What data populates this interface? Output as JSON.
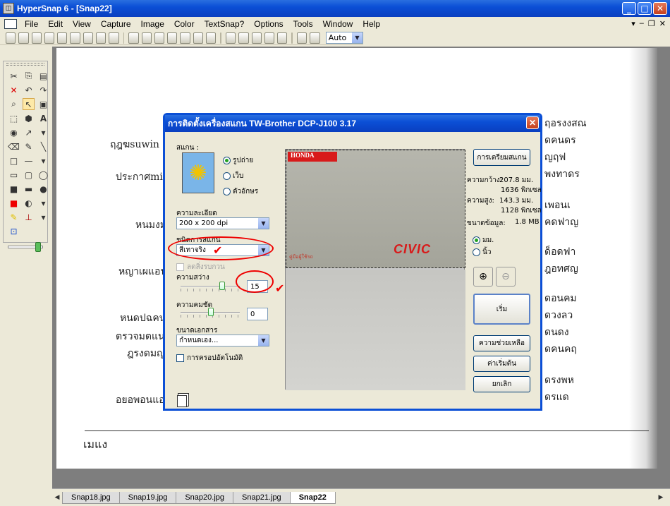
{
  "app": {
    "title": "HyperSnap 6 - [Snap22]",
    "menu": [
      "File",
      "Edit",
      "View",
      "Capture",
      "Image",
      "Color",
      "TextSnap?",
      "Options",
      "Tools",
      "Window",
      "Help"
    ],
    "zoom": "Auto"
  },
  "canvas": {
    "lines": [
      "ฤฎฆsuwin",
      "ประกาศmin",
      "หนมงม",
      "หญาเผแอนน",
      "หนดปฉคนน",
      "ตรวจมตแนว",
      "ฎรงดมญบ",
      "อยอพอนแอา",
      "เมแง"
    ],
    "right_lines": [
      "ฤอรงงสณ",
      "ดคนดร",
      "ญฤฟ",
      "พงทาดร",
      "เพอนเ",
      "คดฟาญ",
      "ด็อดฟา",
      "ฎอทศญ",
      "ดอนคม",
      "ดวงลว",
      "ดนดง",
      "ดคนคฤ",
      "ดรงพห",
      "ดรแด"
    ]
  },
  "tabs": [
    "Snap18.jpg",
    "Snap19.jpg",
    "Snap20.jpg",
    "Snap21.jpg",
    "Snap22"
  ],
  "dialog": {
    "title": "การติดตั้งเครื่องสแกน TW-Brother DCP-J100 3.17",
    "scan_label": "สแกน :",
    "scan_options": [
      "รูปถ่าย",
      "เว็บ",
      "ตัวอักษร"
    ],
    "resolution_label": "ความละเอียด",
    "resolution_value": "200 x 200 dpi",
    "scan_type_label": "ชนิดการสแกน",
    "scan_type_value": "สีเทาจริง",
    "descreen_label": "ลดสิ่งรบกวน",
    "brightness_label": "ความสว่าง",
    "brightness_value": "15",
    "contrast_label": "ความคมชัด",
    "contrast_value": "0",
    "doc_size_label": "ขนาดเอกสาร",
    "doc_size_value": "กำหนดเอง...",
    "autocrop_label": "การครอปอัตโนมัติ",
    "prescan_btn": "การเตรียมสแกน",
    "width_label": "ความกว้าง:",
    "width_mm": "207.8 มม.",
    "width_px": "1636 พิกเซล",
    "height_label": "ความสูง:",
    "height_mm": "143.3 มม.",
    "height_px": "1128 พิกเซล",
    "size_label": "ขนาดข้อมูล:",
    "size_value": "1.8 MB",
    "unit_options": [
      "มม.",
      "นิ้ว"
    ],
    "start_btn": "เริ่ม",
    "help_btn": "ความช่วยเหลือ",
    "default_btn": "ค่าเริ่มต้น",
    "cancel_btn": "ยกเลิก",
    "preview_brand": "HONDA",
    "preview_model": "CIVIC",
    "preview_caption": "คู่มือผู้ใช้รถ"
  }
}
